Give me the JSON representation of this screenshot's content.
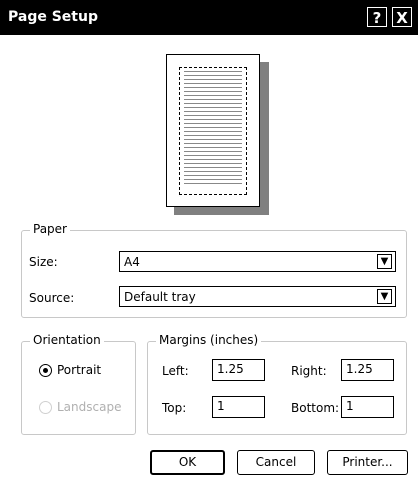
{
  "title": "Page Setup",
  "title_buttons": {
    "help": "?",
    "close": "X"
  },
  "paper": {
    "legend": "Paper",
    "size_label": "Size:",
    "size_value": "A4",
    "source_label": "Source:",
    "source_value": "Default tray"
  },
  "orientation": {
    "legend": "Orientation",
    "portrait_label": "Portrait",
    "landscape_label": "Landscape",
    "selected": "Portrait"
  },
  "margins": {
    "legend": "Margins (inches)",
    "left_label": "Left:",
    "left_value": "1.25",
    "right_label": "Right:",
    "right_value": "1.25",
    "top_label": "Top:",
    "top_value": "1",
    "bottom_label": "Bottom:",
    "bottom_value": "1"
  },
  "buttons": {
    "ok": "OK",
    "cancel": "Cancel",
    "printer": "Printer..."
  },
  "icons": {
    "dropdown": "chevron-down-icon",
    "help": "help-icon",
    "close": "close-icon"
  }
}
